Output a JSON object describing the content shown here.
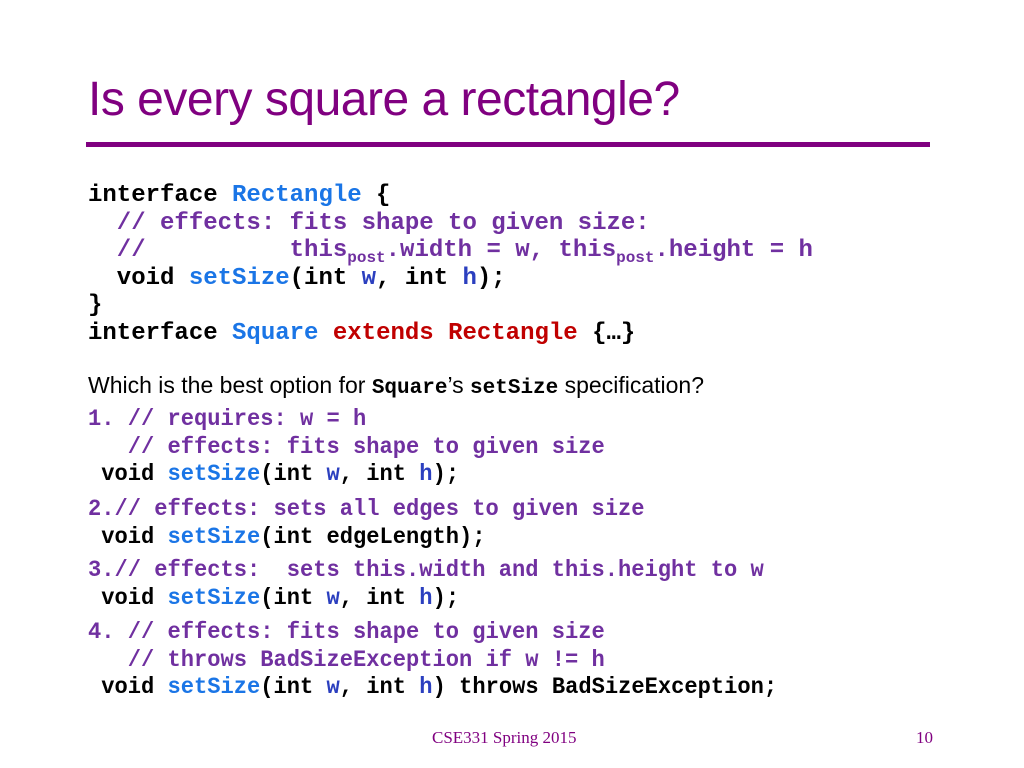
{
  "slide": {
    "title": "Is every square a rectangle?",
    "colors": {
      "title": "#800080",
      "comment": "#7030a0",
      "identifier": "#1a75e6",
      "param": "#2b3fbf",
      "keyword_red": "#c00000"
    },
    "code": {
      "l1_kw": "interface ",
      "l1_name": "Rectangle",
      "l1_brace": " {",
      "l2": "  // effects: fits shape to given size:",
      "l3_a": "  //          this",
      "l3_sub1": "post",
      "l3_b": ".width = w, this",
      "l3_sub2": "post",
      "l3_c": ".height = h",
      "l4_void": "  void ",
      "l4_fn": "setSize",
      "l4_a": "(int ",
      "l4_w": "w",
      "l4_b": ", int ",
      "l4_h": "h",
      "l4_c": ");",
      "l5": "}",
      "l6_kw": "interface ",
      "l6_name": "Square",
      "l6_ext": " extends Rectangle",
      "l6_rest": " {…}"
    },
    "question": {
      "prefix": "Which is the best option for ",
      "square": "Square",
      "apos": "’s ",
      "setsize": "setSize",
      "suffix": "  specification?"
    },
    "options": [
      {
        "c1": "1. // requires: w = h",
        "c2": "   // effects: fits shape to given size",
        "sig_void": " void ",
        "sig_fn": "setSize",
        "sig_a": "(int ",
        "sig_w": "w",
        "sig_b": ", int ",
        "sig_h": "h",
        "sig_c": ");"
      },
      {
        "c1": "2.// effects: sets all edges to given size",
        "sig_void": " void ",
        "sig_fn": "setSize",
        "sig_a": "(int edgeLength);"
      },
      {
        "c1": "3.// effects:  sets this.width and this.height to w",
        "sig_void": " void ",
        "sig_fn": "setSize",
        "sig_a": "(int ",
        "sig_w": "w",
        "sig_b": ", int ",
        "sig_h": "h",
        "sig_c": ");"
      },
      {
        "c1": "4. // effects: fits shape to given size",
        "c2": "   // throws BadSizeException if w != h",
        "sig_void": " void ",
        "sig_fn": "setSize",
        "sig_a": "(int ",
        "sig_w": "w",
        "sig_b": ", int ",
        "sig_h": "h",
        "sig_c": ") throws BadSizeException;"
      }
    ],
    "footer": {
      "course": "CSE331 Spring 2015",
      "page": "10"
    }
  }
}
